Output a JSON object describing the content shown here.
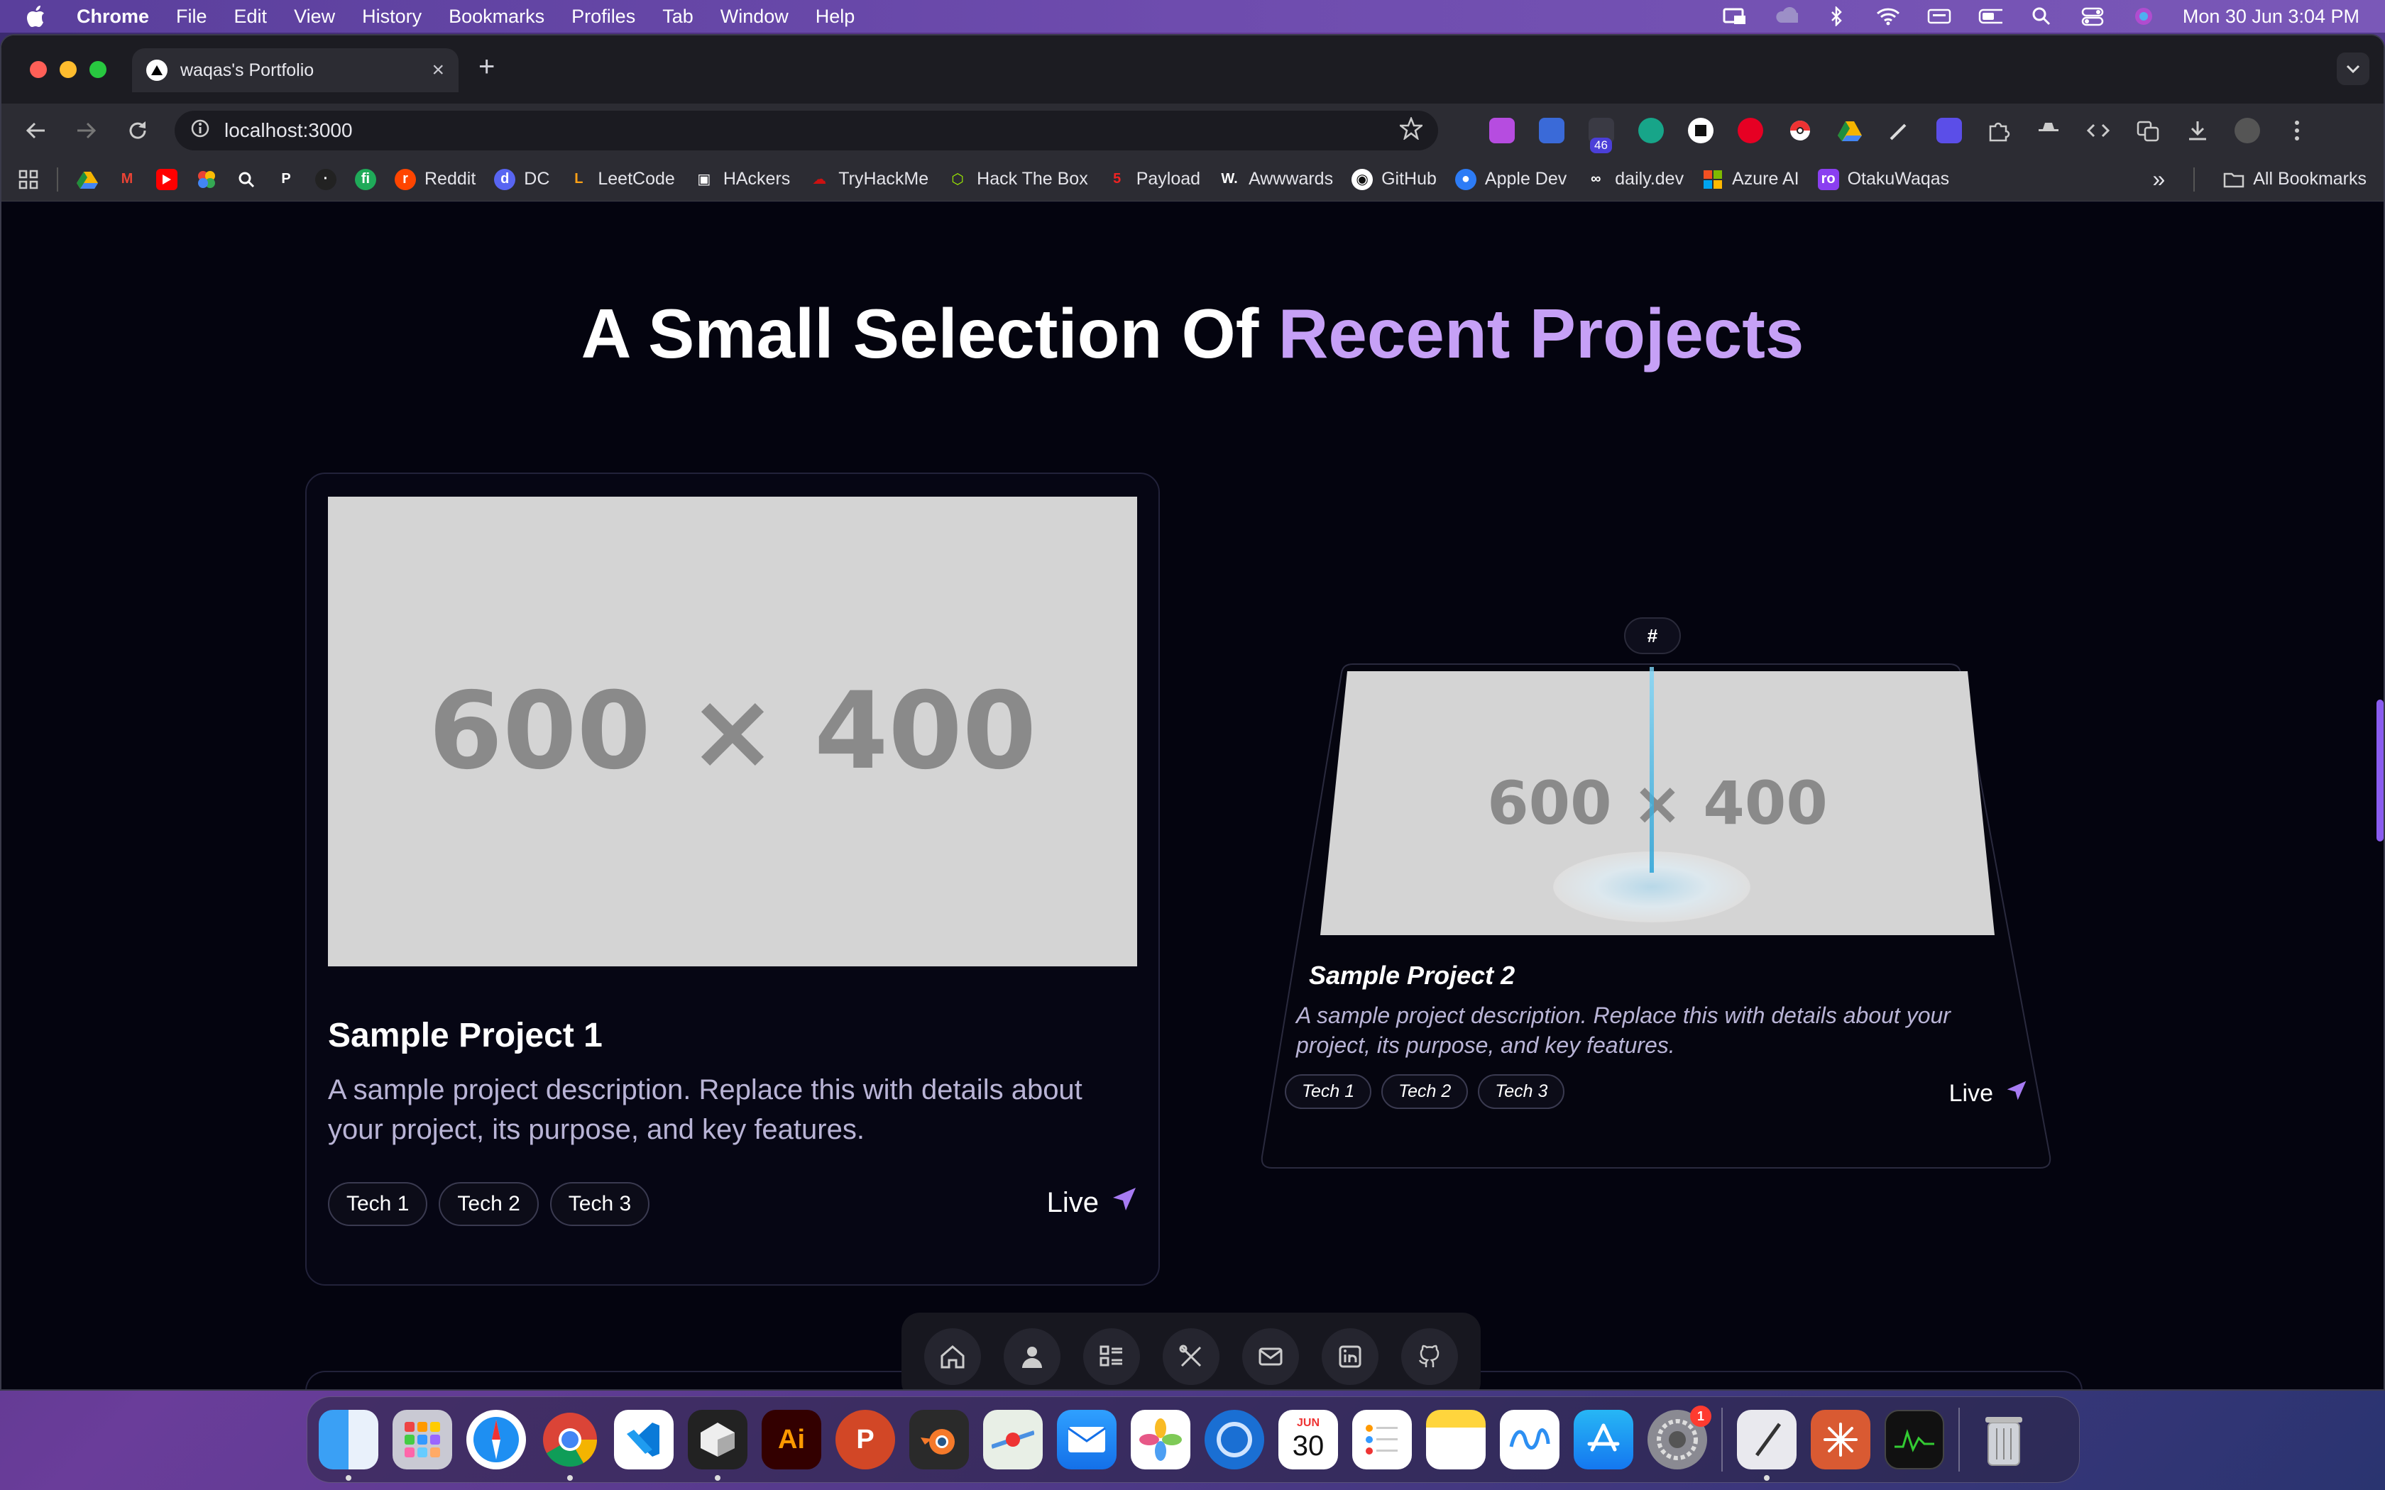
{
  "menubar": {
    "app_name": "Chrome",
    "menus": [
      "File",
      "Edit",
      "View",
      "History",
      "Bookmarks",
      "Profiles",
      "Tab",
      "Window",
      "Help"
    ],
    "clock": "Mon 30 Jun  3:04 PM"
  },
  "browser": {
    "tab_title": "waqas's Portfolio",
    "url": "localhost:3000",
    "extension_badge": "46",
    "bookmarks": [
      "Reddit",
      "DC",
      "LeetCode",
      "HAckers",
      "TryHackMe",
      "Hack The Box",
      "Payload",
      "Awwwards",
      "GitHub",
      "Apple Dev",
      "daily.dev",
      "Azure AI",
      "OtakuWaqas"
    ],
    "all_bookmarks": "All Bookmarks",
    "more": "»"
  },
  "page": {
    "heading_prefix": "A Small Selection Of ",
    "heading_accent": "Recent Projects",
    "projects": [
      {
        "placeholder": "600 × 400",
        "title": "Sample Project 1",
        "description": "A sample project description. Replace this with details about your project, its purpose, and key features.",
        "tags": [
          "Tech 1",
          "Tech 2",
          "Tech 3"
        ],
        "link_label": "Live"
      },
      {
        "pin": "#",
        "placeholder": "600 × 400",
        "title": "Sample Project 2",
        "description": "A sample project description. Replace this with details about your project, its purpose, and key features.",
        "tags": [
          "Tech 1",
          "Tech 2",
          "Tech 3"
        ],
        "link_label": "Live"
      }
    ],
    "floating_nav": [
      "home-icon",
      "user-icon",
      "projects-icon",
      "tools-icon",
      "mail-icon",
      "linkedin-icon",
      "github-icon"
    ]
  },
  "dock": {
    "calendar_month": "JUN",
    "calendar_day": "30",
    "settings_badge": "1",
    "illustrator_label": "Ai",
    "powerpoint_label": "P"
  },
  "colors": {
    "accent": "#c6a0f6",
    "page_bg": "#04040f",
    "send_icon": "#a77bf3"
  }
}
